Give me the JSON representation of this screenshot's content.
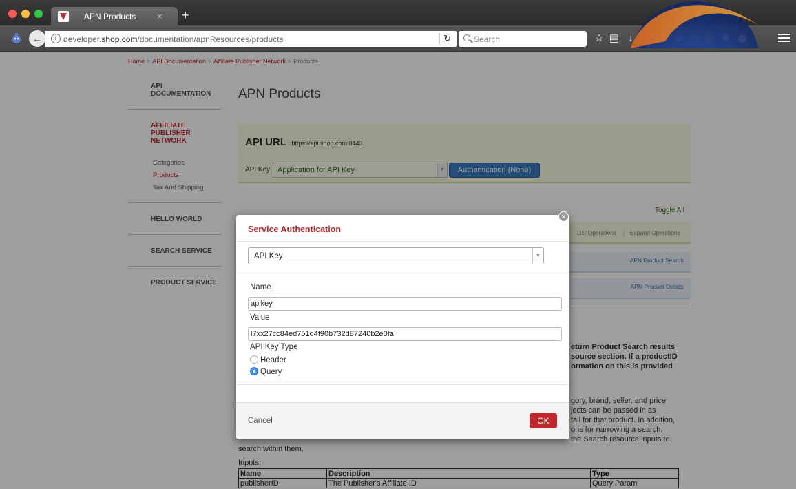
{
  "browser": {
    "tab_title": "APN Products",
    "tab_close": "×",
    "new_tab": "+",
    "url_prefix": "developer.",
    "url_host": "shop.com",
    "url_path": "/documentation/apnResources/products",
    "search_placeholder": "Search"
  },
  "breadcrumb": [
    "Home",
    "API Documentation",
    "Affiliate Publisher Network",
    "Products"
  ],
  "breadcrumb_sep": ">",
  "sidebar": {
    "api_documentation": [
      "API",
      "DOCUMENTATION"
    ],
    "affiliate": [
      "AFFILIATE",
      "PUBLISHER",
      "NETWORK"
    ],
    "affiliate_items": [
      "Categories",
      "Products",
      "Tax And Shipping"
    ],
    "hello_world": "HELLO WORLD",
    "search_service": "SEARCH SERVICE",
    "product_service": "PRODUCT SERVICE"
  },
  "main": {
    "title": "APN Products",
    "api_url_label": "API URL",
    "api_url_value": " : https://api.shop.com:8443",
    "api_key_label": "API Key",
    "api_key_select": "Application for API Key",
    "auth_button": "Authentication (None)",
    "toggle_all": "Toggle All",
    "list_operations": "List Operations",
    "expand_operations": "Expand Operations",
    "ops_sep": "|",
    "resources": [
      "APN Product Search",
      "APN Product Details"
    ],
    "bold_lines": [
      "eturn Product Search results",
      "source section. If a productID",
      "ormation on this is provided"
    ],
    "body_lines": [
      "gory, brand, seller, and price",
      "jects can be passed in as",
      "tail for that product. In addition,",
      "ons for narrowing a search.",
      "the Search resource inputs to"
    ],
    "body_last": "search within them.",
    "inputs_label": "Inputs:",
    "table_headers": [
      "Name",
      "Description",
      "Type"
    ],
    "table_rows": [
      [
        "publisherID",
        "The Publisher's Affiliate ID",
        "Query Param"
      ]
    ]
  },
  "modal": {
    "title": "Service Authentication",
    "close": "×",
    "scheme": "API Key",
    "name_label": "Name",
    "name_value": "apikey",
    "value_label": "Value",
    "value_value": "l7xx27cc84ed751d4f90b732d87240b2e0fa",
    "key_type_label": "API Key Type",
    "option_header": "Header",
    "option_query": "Query",
    "selected": "Query",
    "cancel": "Cancel",
    "ok": "OK"
  },
  "colors": {
    "accent_red": "#c0282d",
    "link_green": "#386e17",
    "auth_blue": "#3b7fc0"
  }
}
